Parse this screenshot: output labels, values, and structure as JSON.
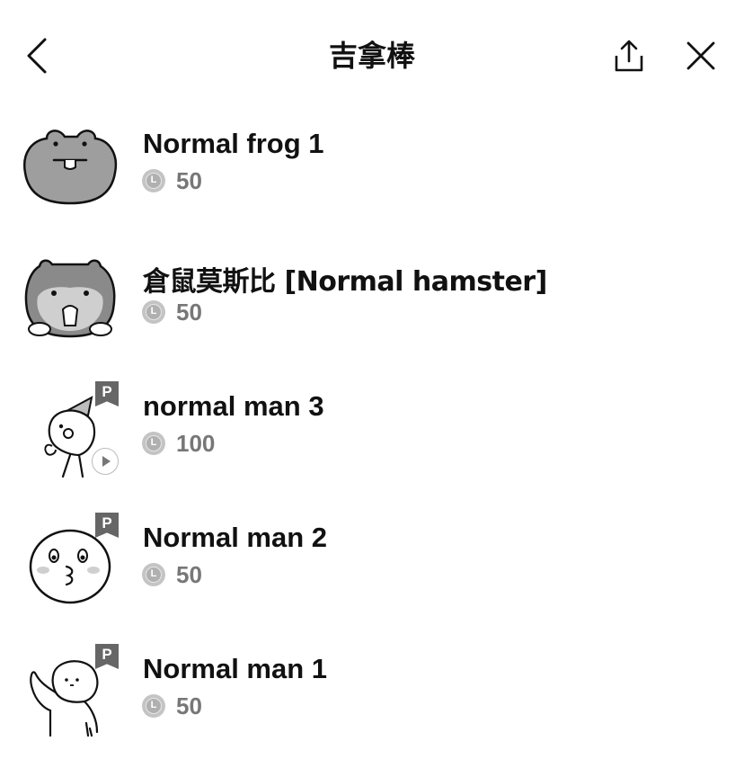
{
  "header": {
    "title": "吉拿棒",
    "back_icon": "chevron-left-icon",
    "share_icon": "share-icon",
    "close_icon": "close-icon"
  },
  "items": [
    {
      "name": "Normal frog 1",
      "price": "50",
      "premium": false,
      "animated": false,
      "thumb": "frog-sticker"
    },
    {
      "name": "倉鼠莫斯比 [Normal hamster]",
      "price": "50",
      "premium": false,
      "animated": false,
      "thumb": "hamster-sticker"
    },
    {
      "name": "normal man 3",
      "price": "100",
      "premium": true,
      "premium_label": "P",
      "animated": true,
      "thumb": "man-party-hat-sticker"
    },
    {
      "name": "Normal man 2",
      "price": "50",
      "premium": true,
      "premium_label": "P",
      "animated": false,
      "thumb": "man-face-sticker"
    },
    {
      "name": "Normal man 1",
      "price": "50",
      "premium": true,
      "premium_label": "P",
      "animated": false,
      "thumb": "man-waving-sticker"
    }
  ],
  "coin_icon": "line-coin-icon",
  "coin_label": "L"
}
